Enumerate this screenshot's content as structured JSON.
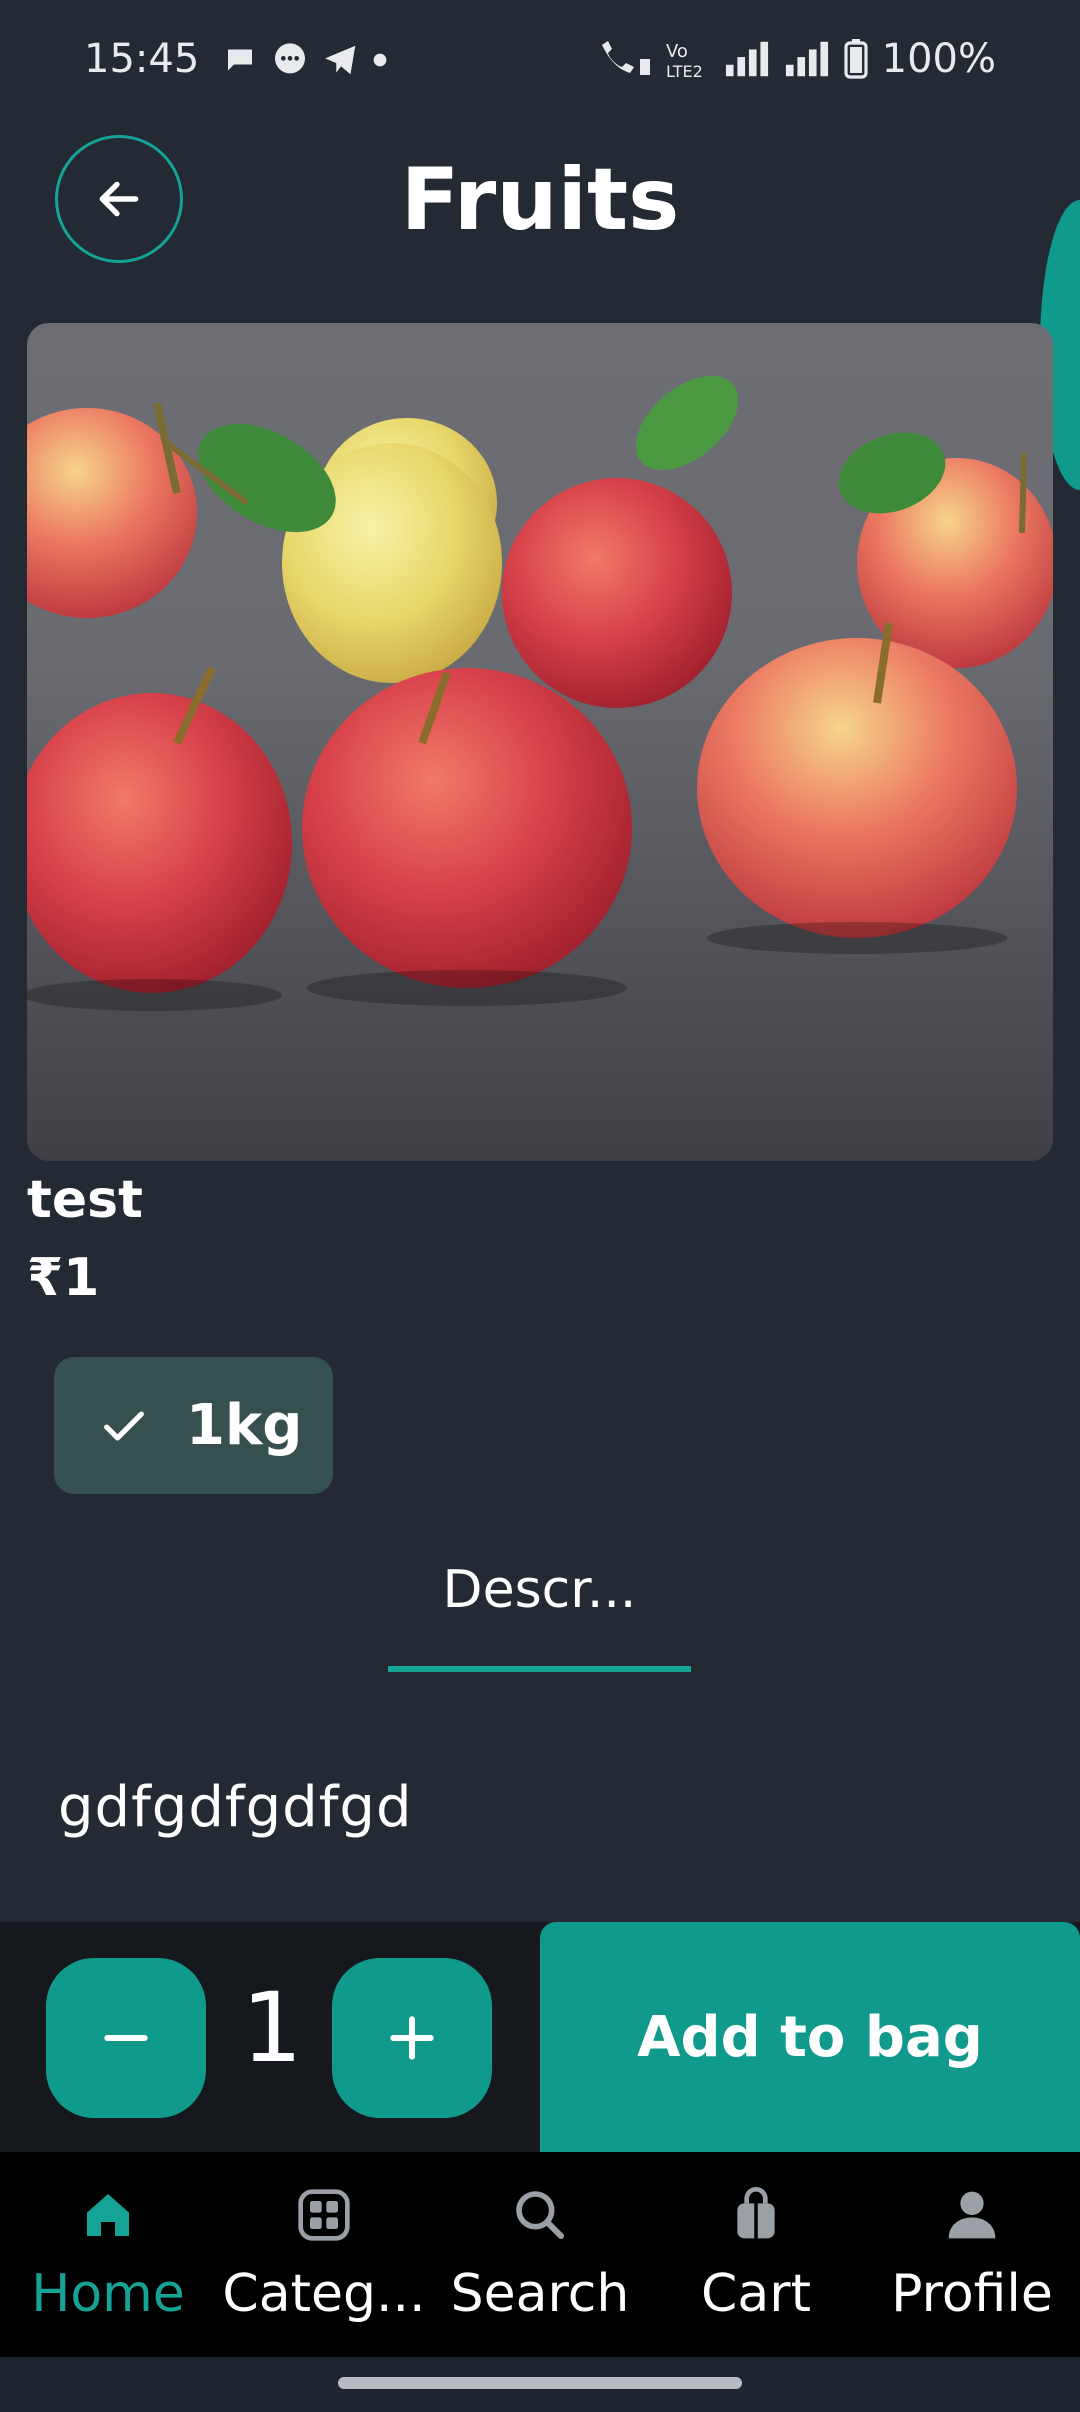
{
  "status_bar": {
    "time": "15:45",
    "battery": "100%",
    "icons": [
      "message-bubble-icon",
      "chat-icon",
      "telegram-icon",
      "dot-icon",
      "wifi-call-icon",
      "volte-icon",
      "signal-icon",
      "signal-icon",
      "battery-icon"
    ]
  },
  "header": {
    "title": "Fruits",
    "back_icon": "arrow-left-icon"
  },
  "product": {
    "name": "test",
    "price": "₹1",
    "image": "red-apples-photo"
  },
  "variant": {
    "label": "1kg",
    "selected": true
  },
  "tabs": {
    "active_label": "Descr..."
  },
  "description": {
    "text": "gdfgdfgdfgd"
  },
  "quantity": {
    "value": "1"
  },
  "cta": {
    "label": "Add to bag"
  },
  "bottom_nav": {
    "items": [
      {
        "label": "Home",
        "icon": "home-icon",
        "active": true
      },
      {
        "label": "Categ...",
        "icon": "grid-icon",
        "active": false
      },
      {
        "label": "Search",
        "icon": "search-icon",
        "active": false
      },
      {
        "label": "Cart",
        "icon": "bag-icon",
        "active": false
      },
      {
        "label": "Profile",
        "icon": "person-icon",
        "active": false
      }
    ]
  },
  "colors": {
    "accent": "#0f9a8b",
    "background": "#232a34",
    "chip": "#36504f"
  }
}
